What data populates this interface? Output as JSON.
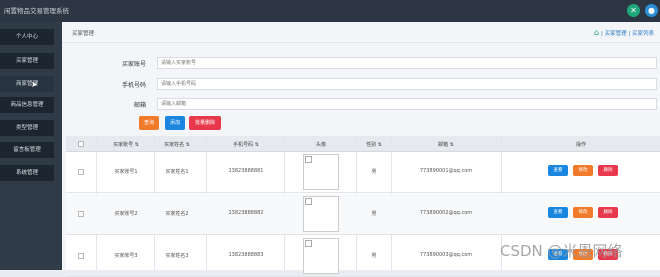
{
  "app": {
    "title": "闲置物品交易管理系统"
  },
  "sidebar": {
    "items": [
      {
        "label": "个人中心"
      },
      {
        "label": "买家管理"
      },
      {
        "label": "商家管理"
      },
      {
        "label": "商品信息管理"
      },
      {
        "label": "类型管理"
      },
      {
        "label": "留言板管理"
      },
      {
        "label": "系统管理"
      }
    ]
  },
  "header": {
    "title": "买家管理",
    "breadcrumb": "| 买家管理 | 买家列表"
  },
  "form": {
    "fields": [
      {
        "label": "买家账号",
        "placeholder": "请输入买家账号"
      },
      {
        "label": "手机号码",
        "placeholder": "请输入手机号码"
      },
      {
        "label": "邮箱",
        "placeholder": "请输入邮箱"
      }
    ],
    "buttons": {
      "search": "查询",
      "add": "添加",
      "batch_delete": "批量删除"
    }
  },
  "table": {
    "headers": [
      "买家账号 ⇅",
      "买家姓名 ⇅",
      "手机号码 ⇅",
      "头像",
      "性别 ⇅",
      "邮箱 ⇅",
      "操作"
    ],
    "rows": [
      {
        "account": "买家账号1",
        "name": "买家姓名1",
        "phone": "13823888881",
        "gender": "男",
        "email": "773890001@qq.com"
      },
      {
        "account": "买家账号2",
        "name": "买家姓名2",
        "phone": "13823888882",
        "gender": "男",
        "email": "773890002@qq.com"
      },
      {
        "account": "买家账号3",
        "name": "买家姓名3",
        "phone": "13823888883",
        "gender": "男",
        "email": "773890003@qq.com"
      }
    ],
    "row_actions": {
      "view": "查看",
      "edit": "修改",
      "delete": "删除"
    }
  },
  "watermark": "CSDN @米恩网络",
  "colors": {
    "accent_orange": "#f07c2b",
    "accent_blue": "#1a86e0",
    "accent_red": "#e8394c",
    "sidebar": "#2f3b47",
    "topbar": "#2d3743"
  }
}
